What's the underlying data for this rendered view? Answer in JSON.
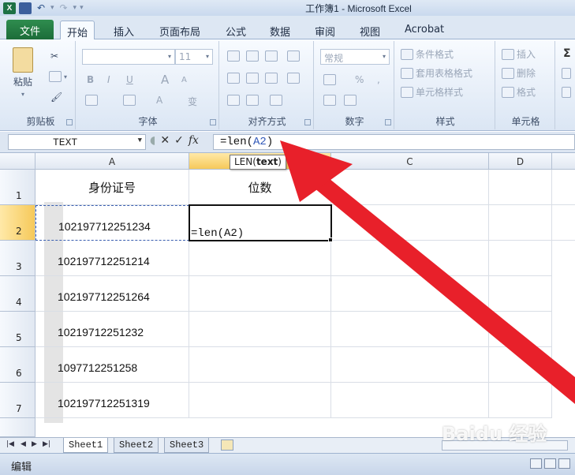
{
  "titlebar": {
    "title": "工作簿1 - Microsoft Excel",
    "qat": {
      "logo": "X",
      "undo": "↶",
      "redo": "↷",
      "customize": "▾"
    }
  },
  "tabs": [
    "文件",
    "开始",
    "插入",
    "页面布局",
    "公式",
    "数据",
    "审阅",
    "视图",
    "Acrobat"
  ],
  "ribbon": {
    "clipboard": {
      "paste": "粘贴",
      "label": "剪贴板"
    },
    "font": {
      "font_name": "",
      "font_size": "11",
      "label": "字体",
      "bold": "B",
      "italic": "I",
      "underline": "U",
      "grow": "A",
      "shrink": "A",
      "color": "A",
      "phonetic": "变"
    },
    "alignment": {
      "label": "对齐方式"
    },
    "number": {
      "format": "常规",
      "percent": "%",
      "comma": ",",
      "label": "数字"
    },
    "styles": {
      "conditional": "条件格式",
      "table": "套用表格格式",
      "cell_styles": "单元格样式",
      "label": "样式"
    },
    "cells": {
      "insert": "插入",
      "delete": "删除",
      "format": "格式",
      "label": "单元格"
    },
    "editing": {
      "sigma": "Σ"
    }
  },
  "formula_bar": {
    "name_box": "TEXT",
    "cancel": "✕",
    "enter": "✓",
    "fx": "fx",
    "formula_prefix": "=len(",
    "formula_ref": "A2",
    "formula_suffix": ")"
  },
  "tooltip": {
    "func": "LEN(",
    "arg": "text",
    "close": ")"
  },
  "columns": [
    "A",
    "B",
    "C",
    "D"
  ],
  "rows": [
    "1",
    "2",
    "3",
    "4",
    "5",
    "6",
    "7"
  ],
  "cells": {
    "A1": "身份证号",
    "B1": "位数",
    "A2": "102197712251234",
    "B2": "=len(A2)",
    "A3": "102197712251214",
    "A4": "102197712251264",
    "A5": "10219712251232",
    "A6": "1097712251258",
    "A7": "102197712251319"
  },
  "sheets": [
    "Sheet1",
    "Sheet2",
    "Sheet3"
  ],
  "status": {
    "mode": "编辑"
  },
  "watermark": "Baidu 经验",
  "colors": {
    "arrow": "#e8202a",
    "file_tab": "#2a8044",
    "active_border": "#111111",
    "ref_blue": "#2f57b8"
  }
}
